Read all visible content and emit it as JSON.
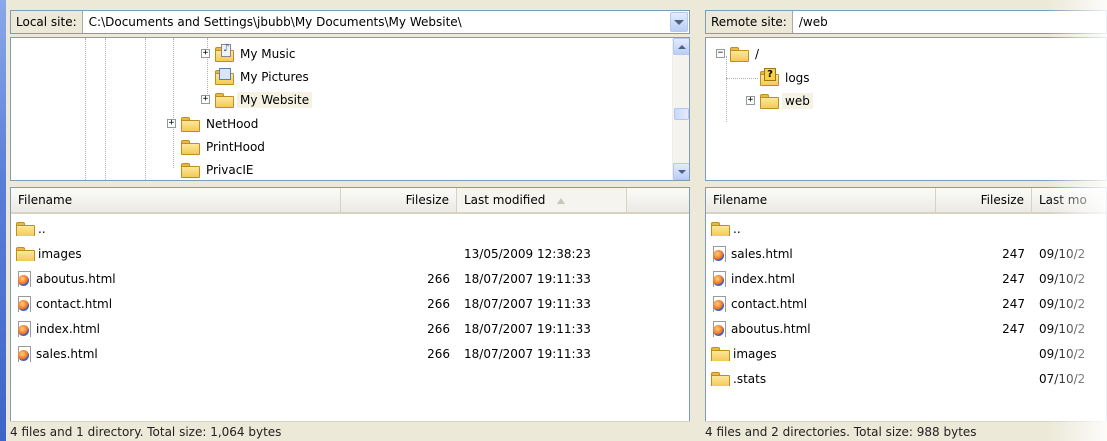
{
  "local": {
    "path_label": "Local site:",
    "path_value": "C:\\Documents and Settings\\jbubb\\My Documents\\My Website\\",
    "tree": [
      {
        "label": "My Music",
        "icon": "music-folder-icon",
        "expander": "+"
      },
      {
        "label": "My Pictures",
        "icon": "pictures-folder-icon",
        "expander": ""
      },
      {
        "label": "My Website",
        "icon": "folder-icon",
        "expander": "+",
        "selected": true
      },
      {
        "label": "NetHood",
        "icon": "folder-icon",
        "expander": "+"
      },
      {
        "label": "PrintHood",
        "icon": "folder-icon",
        "expander": ""
      },
      {
        "label": "PrivacIE",
        "icon": "folder-icon",
        "expander": ""
      }
    ],
    "columns": {
      "filename": "Filename",
      "filesize": "Filesize",
      "last_modified": "Last modified"
    },
    "files": [
      {
        "name": "..",
        "size": "",
        "modified": "",
        "type": "folder"
      },
      {
        "name": "images",
        "size": "",
        "modified": "13/05/2009 12:38:23",
        "type": "folder"
      },
      {
        "name": "aboutus.html",
        "size": "266",
        "modified": "18/07/2007 19:11:33",
        "type": "html"
      },
      {
        "name": "contact.html",
        "size": "266",
        "modified": "18/07/2007 19:11:33",
        "type": "html"
      },
      {
        "name": "index.html",
        "size": "266",
        "modified": "18/07/2007 19:11:33",
        "type": "html"
      },
      {
        "name": "sales.html",
        "size": "266",
        "modified": "18/07/2007 19:11:33",
        "type": "html"
      }
    ],
    "status": "4 files and 1 directory. Total size: 1,064 bytes"
  },
  "remote": {
    "path_label": "Remote site:",
    "path_value": "/web",
    "tree": [
      {
        "label": "/",
        "icon": "folder-icon",
        "expander": "−"
      },
      {
        "label": "logs",
        "icon": "unknown-folder-icon",
        "expander": ""
      },
      {
        "label": "web",
        "icon": "folder-icon",
        "expander": "+",
        "selected": true
      }
    ],
    "columns": {
      "filename": "Filename",
      "filesize": "Filesize",
      "last_modified": "Last mo"
    },
    "files": [
      {
        "name": "..",
        "size": "",
        "modified": "",
        "type": "folder"
      },
      {
        "name": "sales.html",
        "size": "247",
        "modified": "09/10/2",
        "type": "html"
      },
      {
        "name": "index.html",
        "size": "247",
        "modified": "09/10/2",
        "type": "html"
      },
      {
        "name": "contact.html",
        "size": "247",
        "modified": "09/10/2",
        "type": "html"
      },
      {
        "name": "aboutus.html",
        "size": "247",
        "modified": "09/10/2",
        "type": "html"
      },
      {
        "name": "images",
        "size": "",
        "modified": "09/10/2",
        "type": "folder"
      },
      {
        "name": ".stats",
        "size": "",
        "modified": "07/10/2",
        "type": "folder"
      }
    ],
    "status": "4 files and 2 directories. Total size: 988 bytes"
  }
}
